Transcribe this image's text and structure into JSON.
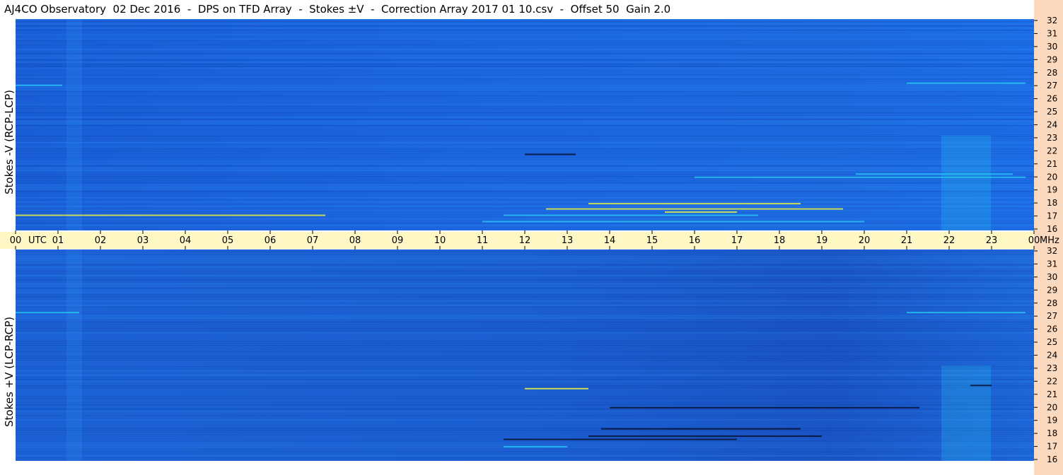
{
  "title": "AJ4CO Observatory  02 Dec 2016  -  DPS on TFD Array  -  Stokes ±V  -  Correction Array 2017 01 10.csv  -  Offset 50  Gain 2.0",
  "colors": {
    "background_blue": "#1f6fe6",
    "deep_blue": "#0b3fa8",
    "cyan": "#26c6f0",
    "yellow": "#e8f040",
    "dark": "#0a1030",
    "utc_strip": "#fff8c4",
    "freq_strip": "#fbd9bf"
  },
  "chart_data": [
    {
      "type": "heatmap",
      "ylabel": "Stokes -V (RCP-LCP)",
      "x_ticks": [
        "00",
        "01",
        "02",
        "03",
        "04",
        "05",
        "06",
        "07",
        "08",
        "09",
        "10",
        "11",
        "12",
        "13",
        "14",
        "15",
        "16",
        "17",
        "18",
        "19",
        "20",
        "21",
        "22",
        "23",
        "00"
      ],
      "x_unit": "UTC",
      "y_ticks": [
        "32",
        "31",
        "30",
        "29",
        "28",
        "27",
        "26",
        "25",
        "24",
        "23",
        "22",
        "21",
        "20",
        "19",
        "18",
        "17",
        "16"
      ],
      "ylim": [
        16,
        32
      ]
    },
    {
      "type": "heatmap",
      "ylabel": "Stokes +V (LCP-RCP)",
      "x_ticks": [
        "00",
        "01",
        "02",
        "03",
        "04",
        "05",
        "06",
        "07",
        "08",
        "09",
        "10",
        "11",
        "12",
        "13",
        "14",
        "15",
        "16",
        "17",
        "18",
        "19",
        "20",
        "21",
        "22",
        "23",
        "00"
      ],
      "x_unit": "UTC",
      "y_ticks": [
        "32",
        "31",
        "30",
        "29",
        "28",
        "27",
        "26",
        "25",
        "24",
        "23",
        "22",
        "21",
        "20",
        "19",
        "18",
        "17",
        "16"
      ],
      "y_unit": "MHz",
      "ylim": [
        16,
        32
      ]
    }
  ]
}
